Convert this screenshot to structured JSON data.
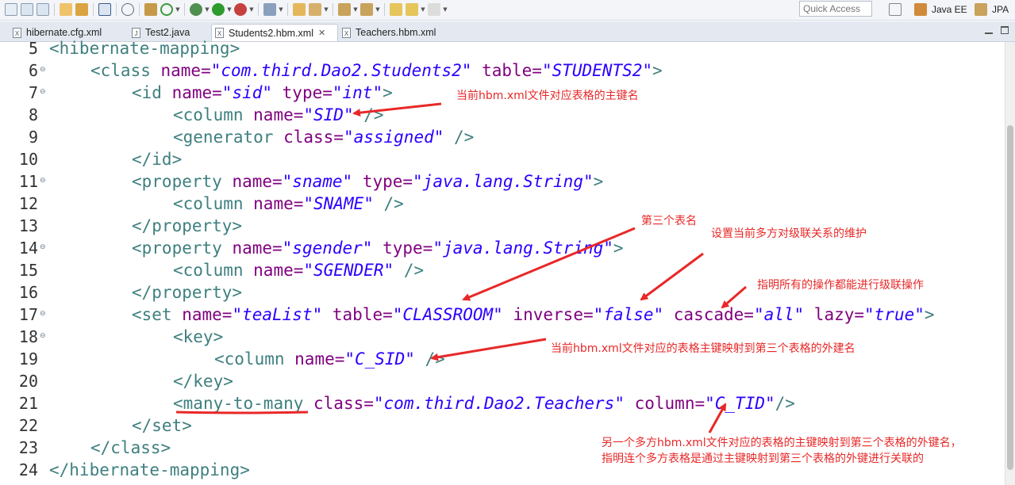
{
  "toolbar": {
    "quick_access_placeholder": "Quick Access",
    "perspectives": [
      {
        "label": "Java EE"
      },
      {
        "label": "JPA"
      }
    ]
  },
  "tabs": [
    {
      "label": "hibernate.cfg.xml",
      "icon": "xml-file-icon",
      "active": false
    },
    {
      "label": "Test2.java",
      "icon": "java-file-icon",
      "active": false
    },
    {
      "label": "Students2.hbm.xml",
      "icon": "xml-file-icon",
      "active": true,
      "close": "✕"
    },
    {
      "label": "Teachers.hbm.xml",
      "icon": "xml-file-icon",
      "active": false
    }
  ],
  "editor": {
    "line_numbers": [
      "5",
      "6",
      "7",
      "8",
      "9",
      "10",
      "11",
      "12",
      "13",
      "14",
      "15",
      "16",
      "17",
      "18",
      "19",
      "20",
      "21",
      "22",
      "23",
      "24"
    ],
    "fold_markers": [
      "6",
      "7",
      "11",
      "14",
      "17",
      "18"
    ],
    "lines": {
      "l5": [
        "<hibernate-mapping>"
      ],
      "l6": [
        "<class",
        " name=",
        "\"com.third.Dao2.Students2\"",
        " table=",
        "\"STUDENTS2\"",
        ">"
      ],
      "l7": [
        "<id",
        " name=",
        "\"sid\"",
        " type=",
        "\"int\"",
        ">"
      ],
      "l8": [
        "<column",
        " name=",
        "\"SID\"",
        " />"
      ],
      "l9": [
        "<generator",
        " class=",
        "\"assigned\"",
        " />"
      ],
      "l10": [
        "</id>"
      ],
      "l11": [
        "<property",
        " name=",
        "\"sname\"",
        " type=",
        "\"java.lang.String\"",
        ">"
      ],
      "l12": [
        "<column",
        " name=",
        "\"SNAME\"",
        " />"
      ],
      "l13": [
        "</property>"
      ],
      "l14": [
        "<property",
        " name=",
        "\"sgender\"",
        " type=",
        "\"java.lang.String\"",
        ">"
      ],
      "l15": [
        "<column",
        " name=",
        "\"SGENDER\"",
        " />"
      ],
      "l16": [
        "</property>"
      ],
      "l17": [
        "<set",
        " name=",
        "\"teaList\"",
        " table=",
        "\"CLASSROOM\"",
        " inverse=",
        "\"false\"",
        " cascade=",
        "\"all\"",
        " lazy=",
        "\"true\"",
        ">"
      ],
      "l18": [
        "<key>"
      ],
      "l19": [
        "<column",
        " name=",
        "\"C_SID\"",
        " />"
      ],
      "l20": [
        "</key>"
      ],
      "l21": [
        "<",
        "many-to-many",
        " class=",
        "\"com.third.Dao2.Teachers\"",
        " column=",
        "\"C_TID\"",
        "/>"
      ],
      "l22": [
        "</set>"
      ],
      "l23": [
        "</class>"
      ],
      "l24": [
        "</hibernate-mapping>"
      ]
    }
  },
  "annotations": {
    "primary_key_column": "当前hbm.xml文件对应表格的主键名",
    "third_table": "第三个表名",
    "inverse_note": "设置当前多方对级联关系的维护",
    "cascade_note": "指明所有的操作都能进行级联操作",
    "fk_note": "当前hbm.xml文件对应的表格主键映射到第三个表格的外建名",
    "other_side_line1": "另一个多方hbm.xml文件对应的表格的主键映射到第三个表格的外键名，",
    "other_side_line2": "指明连个多方表格是通过主键映射到第三个表格的外键进行关联的"
  },
  "colors": {
    "tag": "#3f7f7f",
    "attribute": "#7f007f",
    "string": "#2a00ff",
    "annotation": "#e82828"
  }
}
